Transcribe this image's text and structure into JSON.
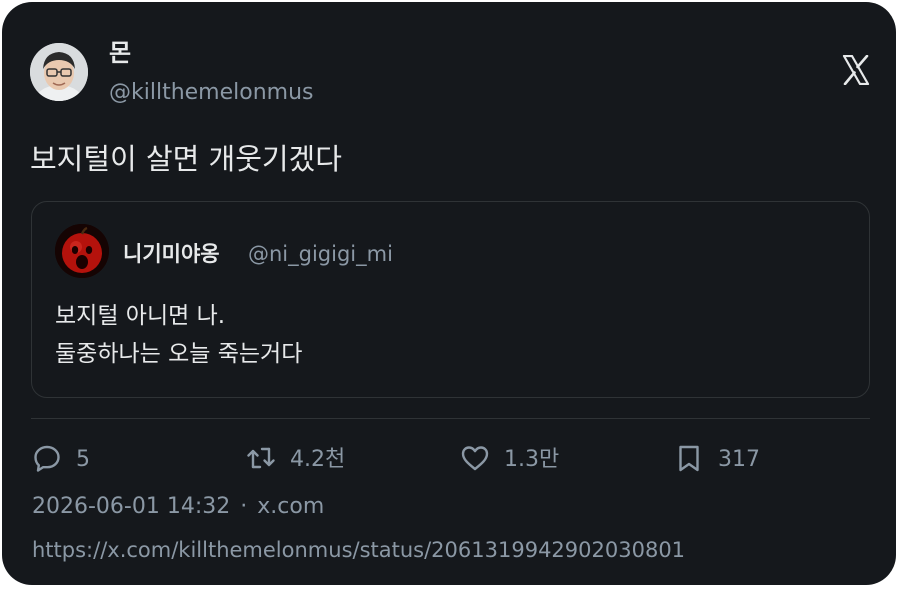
{
  "author": {
    "display_name": "몬",
    "handle": "@killthemelonmus"
  },
  "brand_logo": "x-logo-icon",
  "tweet": {
    "text": "보지털이 살면 개웃기겠다"
  },
  "quoted_tweet": {
    "display_name": "니기미야옹",
    "handle": "@ni_gigigi_mi",
    "lines": [
      "보지털 아니면 나.",
      "둘중하나는 오늘 죽는거다"
    ]
  },
  "actions": {
    "reply": {
      "icon": "reply-bubble-icon",
      "count": "5"
    },
    "retweet": {
      "icon": "retweet-icon",
      "count": "4.2천"
    },
    "like": {
      "icon": "heart-icon",
      "count": "1.3만"
    },
    "bookmark": {
      "icon": "bookmark-icon",
      "count": "317"
    }
  },
  "meta": {
    "timestamp": "2026-06-01 14:32",
    "separator": "·",
    "source": "x.com"
  },
  "status_url": "https://x.com/killthemelonmus/status/2061319942902030801",
  "colors": {
    "card_bg": "#15181c",
    "text_primary": "#e7e9ea",
    "text_secondary": "#8b98a5",
    "border": "#2f3336"
  }
}
